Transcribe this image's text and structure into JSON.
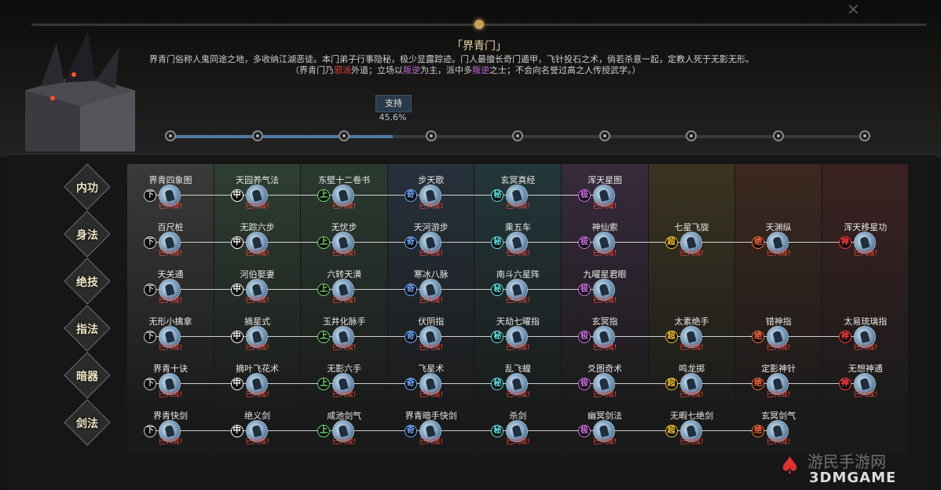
{
  "sect": {
    "name": "「界青门」",
    "desc_line1": "界青门俗称人鬼同途之地，多收纳江湖恶徒。本门弟子行事隐秘，极少显露踪迹。门人最擅长奇门遁甲，飞针投石之术，倘若杀意一起，定教人死于无影无形。",
    "desc_line2_a": "（界青门乃",
    "desc_line2_red": "邪派",
    "desc_line2_b": "外道；立场以",
    "desc_line2_pur1": "叛逆",
    "desc_line2_c": "为主，派中多",
    "desc_line2_pur2": "叛逆",
    "desc_line2_d": "之士；不会向名誉过高之人传授武学。）"
  },
  "support": {
    "label": "支持",
    "percent": "45.6%",
    "fraction": 0.456
  },
  "tiers": [
    "下",
    "中",
    "上",
    "奇",
    "秘",
    "极",
    "超",
    "绝",
    "神"
  ],
  "tier_colors": [
    "#cccccc",
    "#ffffff",
    "#6fdc6f",
    "#6fa8ff",
    "#5fe0e0",
    "#d070e6",
    "#f0c030",
    "#ff6a3a",
    "#ff3a3a"
  ],
  "col_bg": [
    "#3a3a3a",
    "#2f3f33",
    "#2b3a30",
    "#27313c",
    "#23373a",
    "#372a3c",
    "#3a3420",
    "#3c2820",
    "#3b2222"
  ],
  "categories": [
    {
      "label": "内功",
      "icon": "meditation-icon",
      "skills": [
        "界青四象图",
        "天园养气法",
        "东壁十二卷书",
        "步天歌",
        "玄冥真经",
        "浑天星图"
      ]
    },
    {
      "label": "身法",
      "icon": "footwork-icon",
      "skills": [
        "百尺桩",
        "无踪六步",
        "无忧步",
        "天河游步",
        "乘五车",
        "神仙索",
        "七星飞旋",
        "天渊纵",
        "浑天移星功"
      ]
    },
    {
      "label": "绝技",
      "icon": "ultimate-icon",
      "skills": [
        "天关通",
        "河伯娶妻",
        "六转天潢",
        "寒冰八脉",
        "南斗六星阵",
        "九曜星君眼"
      ]
    },
    {
      "label": "指法",
      "icon": "finger-icon",
      "skills": [
        "无形小擒拿",
        "摘星式",
        "玉井化脉手",
        "伏阴指",
        "天劫七曜指",
        "玄冥指",
        "太素绝手",
        "错神指",
        "太易琉璃指"
      ]
    },
    {
      "label": "暗器",
      "icon": "hidden-weapon-icon",
      "skills": [
        "界青十诀",
        "摘叶飞花术",
        "无影六手",
        "飞星术",
        "乱飞蝗",
        "爻图奇术",
        "鸣龙掷",
        "定影神针",
        "无想神通"
      ]
    },
    {
      "label": "剑法",
      "icon": "sword-icon",
      "skills": [
        "界青快剑",
        "绝义剑",
        "咸池剑气",
        "界青暗手快剑",
        "杀剑",
        "幽冥剑法",
        "无暇七绝剑",
        "玄冥剑气"
      ]
    }
  ],
  "done_label": "已大成!",
  "watermark": {
    "cn": "游民手游网",
    "en": "3DMGAME"
  }
}
